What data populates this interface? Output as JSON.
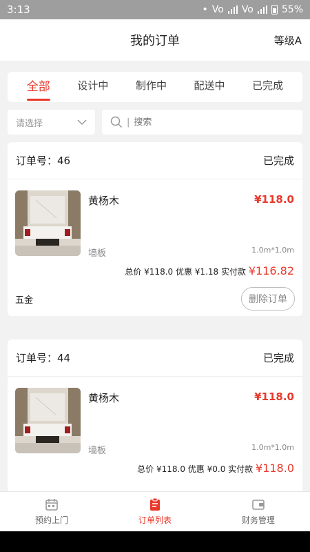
{
  "status": {
    "time": "3:13",
    "network1": "Vo",
    "network2": "Vo",
    "battery": "55%"
  },
  "header": {
    "title": "我的订单",
    "level": "等级A"
  },
  "tabs": [
    {
      "label": "全部"
    },
    {
      "label": "设计中"
    },
    {
      "label": "制作中"
    },
    {
      "label": "配送中"
    },
    {
      "label": "已完成"
    }
  ],
  "filter": {
    "select_placeholder": "请选择",
    "search_placeholder": "搜索"
  },
  "orders": [
    {
      "order_label": "订单号：46",
      "status": "已完成",
      "item_name": "黄杨木",
      "item_price": "¥118.0",
      "item_category": "墙板",
      "item_size": "1.0m*1.0m",
      "summary_total": "总价 ¥118.0",
      "summary_discount": "优惠 ¥1.18",
      "summary_pay_label": "实付款",
      "summary_pay_value": "¥116.82",
      "extra": "五金",
      "delete_label": "删除订单"
    },
    {
      "order_label": "订单号：44",
      "status": "已完成",
      "item_name": "黄杨木",
      "item_price": "¥118.0",
      "item_category": "墙板",
      "item_size": "1.0m*1.0m",
      "summary_total": "总价 ¥118.0",
      "summary_discount": "优惠 ¥0.0",
      "summary_pay_label": "实付款",
      "summary_pay_value": "¥118.0"
    }
  ],
  "tabbar": [
    {
      "label": "预约上门",
      "icon": "calendar-icon"
    },
    {
      "label": "订单列表",
      "icon": "clipboard-icon"
    },
    {
      "label": "财务管理",
      "icon": "wallet-icon"
    }
  ],
  "colors": {
    "accent": "#e8382a",
    "background": "#f2f2f2",
    "statusbar": "#9e9e9e"
  }
}
